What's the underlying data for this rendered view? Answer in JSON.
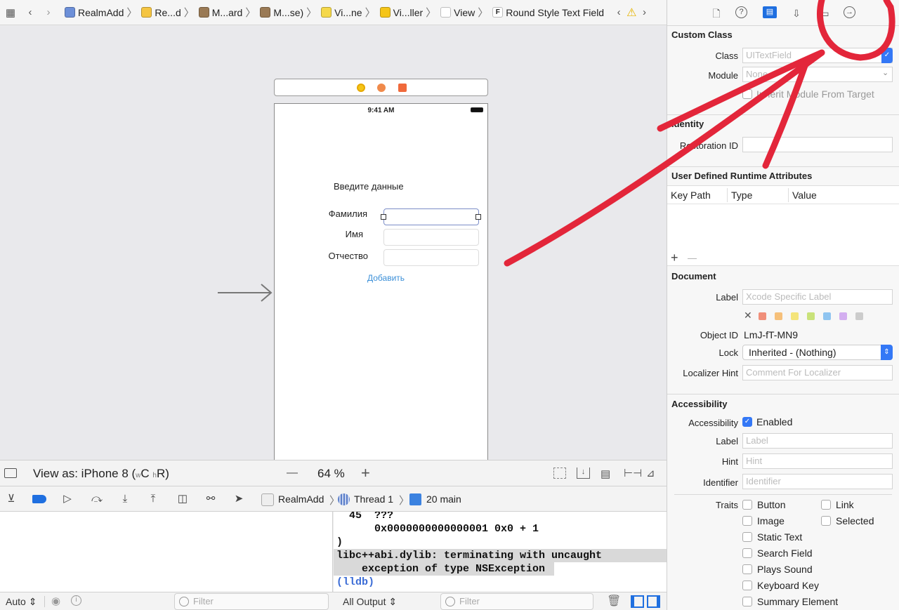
{
  "breadcrumb": [
    {
      "label": "RealmAdd",
      "color": "#6c8fd8"
    },
    {
      "label": "Re...d",
      "color": "#f5c542"
    },
    {
      "label": "M...ard",
      "color": "#9a7a55"
    },
    {
      "label": "M...se)",
      "color": "#9a7a55"
    },
    {
      "label": "Vi...ne",
      "color": "#f5d84a"
    },
    {
      "label": "Vi...ller",
      "color": "#f5c518"
    },
    {
      "label": "View",
      "color": "#ffffff"
    },
    {
      "label": "Round Style Text Field",
      "color": "#ffffff",
      "glyph": "F"
    }
  ],
  "phone": {
    "time": "9:41 AM",
    "heading": "Введите данные",
    "field1": "Фамилия",
    "field2": "Имя",
    "field3": "Отчество",
    "button": "Добавить"
  },
  "canvas_bar": {
    "view_as": "View as: iPhone 8 (",
    "size_w": "w",
    "size_wv": "C",
    "size_h": "h",
    "size_hv": "R",
    "size_close": ")",
    "zoom": "64 %",
    "zoom_out": "—",
    "zoom_in": "+"
  },
  "debug_bar": {
    "target": "RealmAdd",
    "thread": "Thread 1",
    "frame": "20 main"
  },
  "console_lines": [
    "  45  ???",
    "      0x0000000000000001 0x0 + 1",
    ")",
    "libc++abi.dylib: terminating with uncaught",
    "    exception of type NSException",
    "(lldb)"
  ],
  "bottom_bar": {
    "auto": "Auto",
    "filter_placeholder": "Filter",
    "all_output": "All Output",
    "filter2_placeholder": "Filter"
  },
  "inspector": {
    "custom_class": {
      "title": "Custom Class",
      "class_label": "Class",
      "class_placeholder": "UITextField",
      "module_label": "Module",
      "module_placeholder": "None",
      "inherit_label": "Inherit Module From Target"
    },
    "identity": {
      "title": "Identity",
      "restoration_label": "Restoration ID"
    },
    "udra": {
      "title": "User Defined Runtime Attributes",
      "col_keypath": "Key Path",
      "col_type": "Type",
      "col_value": "Value",
      "add": "+",
      "remove": "—"
    },
    "document": {
      "title": "Document",
      "label_label": "Label",
      "label_placeholder": "Xcode Specific Label",
      "object_id_label": "Object ID",
      "object_id": "LmJ-fT-MN9",
      "lock_label": "Lock",
      "lock_value": "Inherited - (Nothing)",
      "hint_label": "Localizer Hint",
      "hint_placeholder": "Comment For Localizer",
      "swatches": [
        "#f08f7a",
        "#f6c07a",
        "#f4e47a",
        "#c9e27a",
        "#8fc4f0",
        "#d3aef0",
        "#cccccc"
      ]
    },
    "accessibility": {
      "title": "Accessibility",
      "acc_label": "Accessibility",
      "enabled": "Enabled",
      "label_label": "Label",
      "label_placeholder": "Label",
      "hint_label": "Hint",
      "hint_placeholder": "Hint",
      "identifier_label": "Identifier",
      "identifier_placeholder": "Identifier",
      "traits_label": "Traits",
      "traits_left": [
        "Button",
        "Image",
        "Static Text",
        "Search Field",
        "Plays Sound",
        "Keyboard Key",
        "Summary Element"
      ],
      "traits_right": [
        "Link",
        "Selected"
      ]
    }
  },
  "annotation_color": "#e3263a"
}
